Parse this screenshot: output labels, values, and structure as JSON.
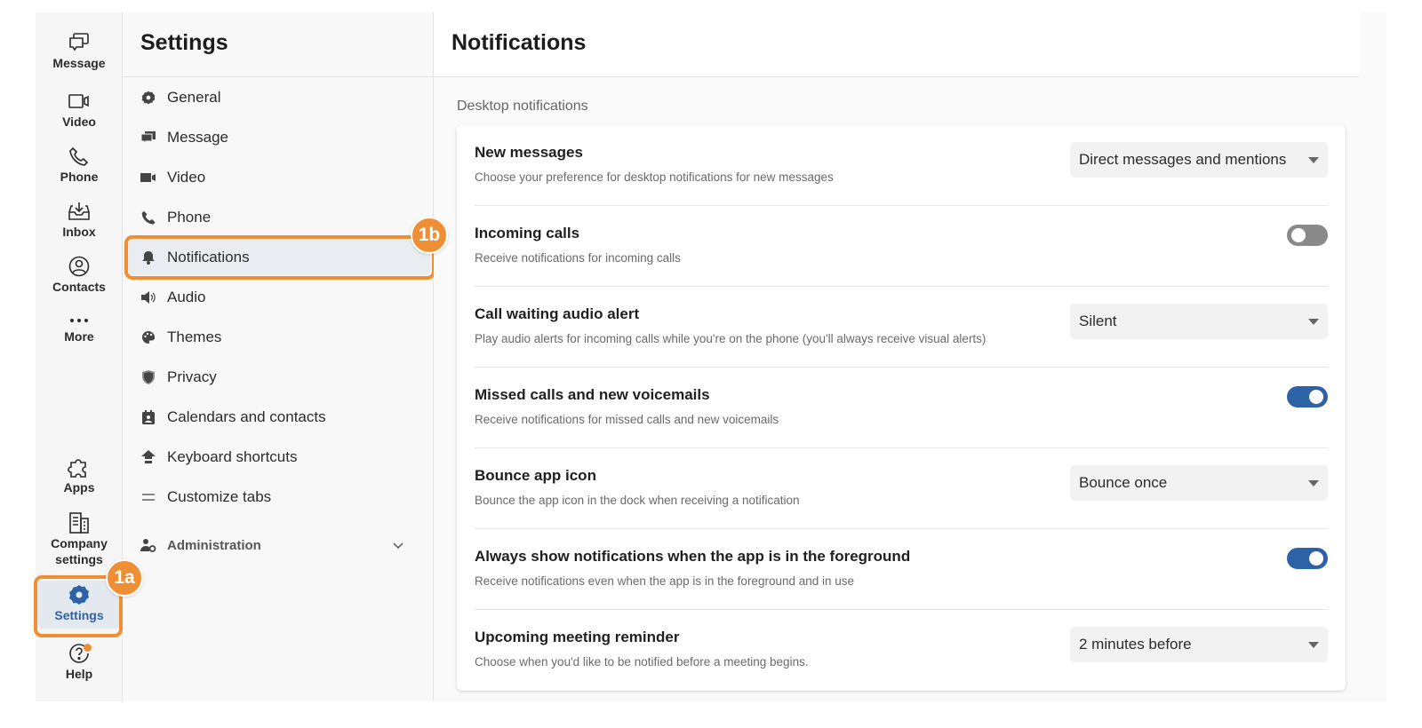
{
  "rail": {
    "items": [
      {
        "label": "Message",
        "icon": "message-icon"
      },
      {
        "label": "Video",
        "icon": "video-icon"
      },
      {
        "label": "Phone",
        "icon": "phone-icon"
      },
      {
        "label": "Inbox",
        "icon": "inbox-icon"
      },
      {
        "label": "Contacts",
        "icon": "contacts-icon"
      },
      {
        "label": "More",
        "icon": "more-icon"
      }
    ],
    "bottom_items": [
      {
        "label": "Apps",
        "icon": "puzzle-icon"
      },
      {
        "label": "Company settings",
        "label_line1": "Company",
        "label_line2": "settings",
        "icon": "building-icon"
      },
      {
        "label": "Settings",
        "icon": "gear-icon",
        "active": true
      },
      {
        "label": "Help",
        "icon": "help-icon"
      }
    ]
  },
  "nav": {
    "title": "Settings",
    "items": [
      {
        "label": "General",
        "icon": "gear-icon"
      },
      {
        "label": "Message",
        "icon": "message-icon"
      },
      {
        "label": "Video",
        "icon": "video-icon"
      },
      {
        "label": "Phone",
        "icon": "phone-icon"
      },
      {
        "label": "Notifications",
        "icon": "bell-icon",
        "active": true
      },
      {
        "label": "Audio",
        "icon": "speaker-icon"
      },
      {
        "label": "Themes",
        "icon": "palette-icon"
      },
      {
        "label": "Privacy",
        "icon": "shield-icon"
      },
      {
        "label": "Calendars and contacts",
        "icon": "calendar-icon"
      },
      {
        "label": "Keyboard shortcuts",
        "icon": "keyboard-icon"
      },
      {
        "label": "Customize tabs",
        "icon": "lines-icon"
      },
      {
        "label": "Administration",
        "icon": "admin-icon"
      }
    ]
  },
  "annotations": {
    "badge_1a": "1a",
    "badge_1b": "1b",
    "highlight_color": "#ef8f35"
  },
  "main": {
    "title": "Notifications",
    "section_label": "Desktop notifications",
    "rows": [
      {
        "title": "New messages",
        "description": "Choose your preference for desktop notifications for new messages",
        "control": "select",
        "value": "Direct messages and mentions"
      },
      {
        "title": "Incoming calls",
        "description": "Receive notifications for incoming calls",
        "control": "toggle",
        "value": false
      },
      {
        "title": "Call waiting audio alert",
        "description": "Play audio alerts for incoming calls while you're on the phone (you'll always receive visual alerts)",
        "control": "select",
        "value": "Silent"
      },
      {
        "title": "Missed calls and new voicemails",
        "description": "Receive notifications for missed calls and new voicemails",
        "control": "toggle",
        "value": true
      },
      {
        "title": "Bounce app icon",
        "description": "Bounce the app icon in the dock when receiving a notification",
        "control": "select",
        "value": "Bounce once"
      },
      {
        "title": "Always show notifications when the app is in the foreground",
        "description": "Receive notifications even when the app is in the foreground and in use",
        "control": "toggle",
        "value": true
      },
      {
        "title": "Upcoming meeting reminder",
        "description": "Choose when you'd like to be notified before a meeting begins.",
        "control": "select",
        "value": "2 minutes before"
      }
    ]
  },
  "colors": {
    "accent": "#2d62a6",
    "toggle_off": "#8a8a8a",
    "annotation": "#ef8f35"
  }
}
